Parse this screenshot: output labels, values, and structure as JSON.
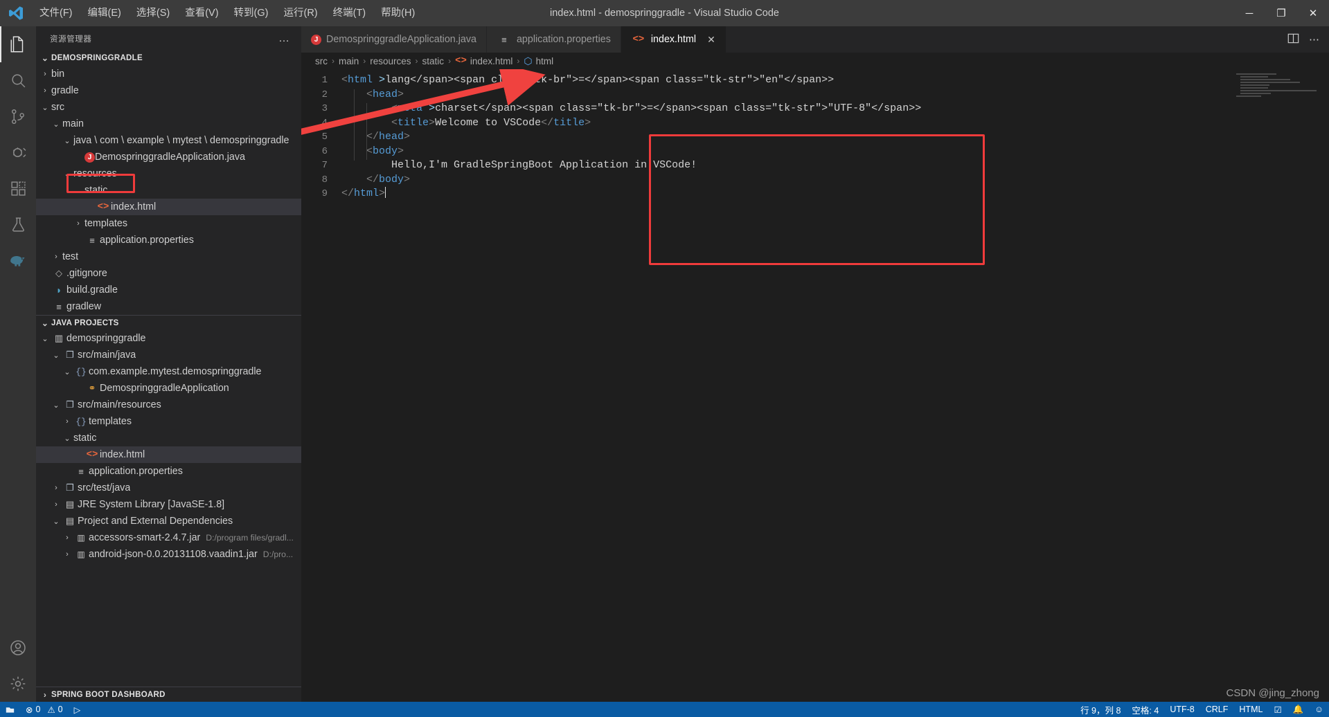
{
  "window": {
    "title": "index.html - demospringgradle - Visual Studio Code",
    "logo_icon": "vscode-logo-icon",
    "minimize_icon": "minimize-icon",
    "maximize_icon": "maximize-icon",
    "close_icon": "close-icon",
    "minimize": "─",
    "maximize": "❐",
    "close": "✕"
  },
  "menu": [
    {
      "label": "文件(F)"
    },
    {
      "label": "编辑(E)"
    },
    {
      "label": "选择(S)"
    },
    {
      "label": "查看(V)"
    },
    {
      "label": "转到(G)"
    },
    {
      "label": "运行(R)"
    },
    {
      "label": "终端(T)"
    },
    {
      "label": "帮助(H)"
    }
  ],
  "activitybar": [
    {
      "name": "explorer",
      "icon": "files-icon",
      "active": true
    },
    {
      "name": "search",
      "icon": "search-icon",
      "active": false
    },
    {
      "name": "source-control",
      "icon": "source-control-icon",
      "active": false
    },
    {
      "name": "run-and-debug",
      "icon": "debug-icon",
      "active": false
    },
    {
      "name": "extensions",
      "icon": "extensions-icon",
      "active": false
    },
    {
      "name": "testing",
      "icon": "beaker-icon",
      "active": false
    },
    {
      "name": "gradle",
      "icon": "gradle-elephant-icon",
      "active": false
    },
    {
      "name": "accounts",
      "icon": "account-icon",
      "active": false
    },
    {
      "name": "settings",
      "icon": "gear-icon",
      "active": false
    }
  ],
  "sidebar": {
    "title": "资源管理器",
    "more_actions": "…",
    "explorer": {
      "header": "DEMOSPRINGGRADLE",
      "items": [
        {
          "label": "bin",
          "indent": 1,
          "twisty": "›",
          "icon": "",
          "icontype": "none"
        },
        {
          "label": "gradle",
          "indent": 1,
          "twisty": "›",
          "icon": "",
          "icontype": "none"
        },
        {
          "label": "src",
          "indent": 1,
          "twisty": "⌄",
          "icon": "",
          "icontype": "none"
        },
        {
          "label": "main",
          "indent": 2,
          "twisty": "⌄",
          "icon": "",
          "icontype": "none"
        },
        {
          "label": "java \\ com \\ example \\ mytest \\ demospringgradle",
          "indent": 3,
          "twisty": "⌄",
          "icon": "",
          "icontype": "none"
        },
        {
          "label": "DemospringgradleApplication.java",
          "indent": 4,
          "twisty": "",
          "icon": "J",
          "icontype": "java"
        },
        {
          "label": "resources",
          "indent": 3,
          "twisty": "⌄",
          "icon": "",
          "icontype": "none"
        },
        {
          "label": "static",
          "indent": 4,
          "twisty": "⌄",
          "icon": "",
          "icontype": "none"
        },
        {
          "label": "index.html",
          "indent": 5,
          "twisty": "",
          "icon": "<>",
          "icontype": "html",
          "selected": true
        },
        {
          "label": "templates",
          "indent": 4,
          "twisty": "›",
          "icon": "",
          "icontype": "none"
        },
        {
          "label": "application.properties",
          "indent": 4,
          "twisty": "",
          "icon": "≡",
          "icontype": "props"
        },
        {
          "label": "test",
          "indent": 2,
          "twisty": "›",
          "icon": "",
          "icontype": "none"
        },
        {
          "label": ".gitignore",
          "indent": 1,
          "twisty": "",
          "icon": "◇",
          "icontype": "git"
        },
        {
          "label": "build.gradle",
          "indent": 1,
          "twisty": "",
          "icon": "◗",
          "icontype": "gradle"
        },
        {
          "label": "gradlew",
          "indent": 1,
          "twisty": "",
          "icon": "≡",
          "icontype": "props"
        }
      ]
    },
    "java_projects": {
      "header": "JAVA PROJECTS",
      "items": [
        {
          "label": "demospringgradle",
          "indent": 1,
          "twisty": "⌄",
          "icon": "▥",
          "icontype": "proj"
        },
        {
          "label": "src/main/java",
          "indent": 2,
          "twisty": "⌄",
          "icon": "❐",
          "icontype": "folder"
        },
        {
          "label": "com.example.mytest.demospringgradle",
          "indent": 3,
          "twisty": "⌄",
          "icon": "{}",
          "icontype": "pkg"
        },
        {
          "label": "DemospringgradleApplication",
          "indent": 4,
          "twisty": "",
          "icon": "⚭",
          "icontype": "class"
        },
        {
          "label": "src/main/resources",
          "indent": 2,
          "twisty": "⌄",
          "icon": "❐",
          "icontype": "folder"
        },
        {
          "label": "templates",
          "indent": 3,
          "twisty": "›",
          "icon": "{}",
          "icontype": "pkg"
        },
        {
          "label": "static",
          "indent": 3,
          "twisty": "⌄",
          "icon": "",
          "icontype": "none"
        },
        {
          "label": "index.html",
          "indent": 4,
          "twisty": "",
          "icon": "<>",
          "icontype": "html",
          "selected": true
        },
        {
          "label": "application.properties",
          "indent": 3,
          "twisty": "",
          "icon": "≡",
          "icontype": "props"
        },
        {
          "label": "src/test/java",
          "indent": 2,
          "twisty": "›",
          "icon": "❐",
          "icontype": "folder"
        },
        {
          "label": "JRE System Library [JavaSE-1.8]",
          "indent": 2,
          "twisty": "›",
          "icon": "▤",
          "icontype": "lib"
        },
        {
          "label": "Project and External Dependencies",
          "indent": 2,
          "twisty": "⌄",
          "icon": "▤",
          "icontype": "lib"
        },
        {
          "label": "accessors-smart-2.4.7.jar",
          "indent": 3,
          "twisty": "›",
          "icon": "▥",
          "icontype": "jar",
          "sub": "D:/program files/gradl..."
        },
        {
          "label": "android-json-0.0.20131108.vaadin1.jar",
          "indent": 3,
          "twisty": "›",
          "icon": "▥",
          "icontype": "jar",
          "sub": "D:/pro..."
        }
      ]
    },
    "spring_boot_dashboard": {
      "header": "SPRING BOOT DASHBOARD",
      "twisty": "›"
    }
  },
  "tabs": [
    {
      "label": "DemospringgradleApplication.java",
      "icon": "java-file-icon",
      "icon_glyph": "J",
      "icontype": "java",
      "active": false,
      "closable": false
    },
    {
      "label": "application.properties",
      "icon": "properties-file-icon",
      "icon_glyph": "≡",
      "icontype": "props",
      "active": false,
      "closable": false
    },
    {
      "label": "index.html",
      "icon": "html-file-icon",
      "icon_glyph": "<>",
      "icontype": "html",
      "active": true,
      "closable": true,
      "close_glyph": "✕"
    }
  ],
  "editor_actions": [
    {
      "name": "split-editor-icon",
      "glyph": "⬚"
    },
    {
      "name": "more-actions-icon",
      "glyph": "⋯"
    }
  ],
  "breadcrumb": [
    {
      "label": "src",
      "icon": ""
    },
    {
      "label": "main",
      "icon": ""
    },
    {
      "label": "resources",
      "icon": ""
    },
    {
      "label": "static",
      "icon": ""
    },
    {
      "label": "index.html",
      "icon": "<>",
      "icontype": "html"
    },
    {
      "label": "html",
      "icon": "⬡",
      "icontype": "symbol"
    }
  ],
  "code": {
    "language": "html",
    "line_numbers": [
      "1",
      "2",
      "3",
      "4",
      "5",
      "6",
      "7",
      "8",
      "9"
    ],
    "lines": [
      "<html lang=\"en\">",
      "    <head>",
      "        <meta charset=\"UTF-8\">",
      "        <title>Welcome to VSCode</title>",
      "    </head>",
      "    <body>",
      "        Hello,I'm GradleSpringBoot Application in VSCode!",
      "    </body>",
      "</html>"
    ]
  },
  "annotations": {
    "box_color": "#ef3b3b",
    "arrow_color": "#f0423f",
    "code_box": "highlight around html source",
    "sidebar_box": "highlight around index.html file",
    "arrow": "arrow from sidebar index.html to editor top"
  },
  "statusbar": {
    "left": [
      {
        "name": "remote-indicator",
        "glyph": "⌧"
      },
      {
        "name": "problems",
        "glyph": "⊗",
        "errors": "0",
        "warn_glyph": "⚠",
        "warnings": "0"
      },
      {
        "name": "run-button",
        "glyph": "▷"
      }
    ],
    "right": [
      {
        "name": "editor-position",
        "label": "行 9，列 8"
      },
      {
        "name": "indentation",
        "label": "空格: 4"
      },
      {
        "name": "encoding",
        "label": "UTF-8"
      },
      {
        "name": "eol",
        "label": "CRLF"
      },
      {
        "name": "language-mode",
        "label": "HTML"
      },
      {
        "name": "notifications",
        "label": "☑"
      },
      {
        "name": "bell",
        "label": "🔔"
      },
      {
        "name": "smiley-feedback",
        "label": "☺"
      }
    ]
  },
  "watermark": "CSDN @jing_zhong"
}
